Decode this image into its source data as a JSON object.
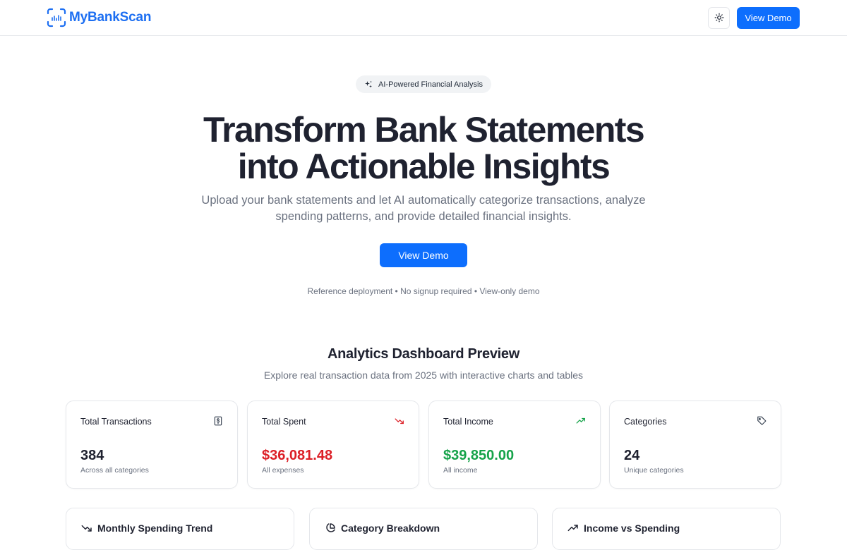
{
  "header": {
    "brand": "MyBankScan",
    "view_demo_label": "View Demo"
  },
  "hero": {
    "badge": "AI-Powered Financial Analysis",
    "title_line1": "Transform Bank Statements",
    "title_line2": "into Actionable Insights",
    "subtitle": "Upload your bank statements and let AI automatically categorize transactions, analyze spending patterns, and provide detailed financial insights.",
    "cta_label": "View Demo",
    "note": "Reference deployment • No signup required • View-only demo"
  },
  "preview": {
    "title": "Analytics Dashboard Preview",
    "subtitle": "Explore real transaction data from 2025 with interactive charts and tables",
    "stats": [
      {
        "label": "Total Transactions",
        "value": "384",
        "desc": "Across all categories",
        "icon": "receipt-icon",
        "color": "#1f2230"
      },
      {
        "label": "Total Spent",
        "value": "$36,081.48",
        "desc": "All expenses",
        "icon": "trending-down-icon",
        "color": "#dc1f26"
      },
      {
        "label": "Total Income",
        "value": "$39,850.00",
        "desc": "All income",
        "icon": "trending-up-icon",
        "color": "#16a34a"
      },
      {
        "label": "Categories",
        "value": "24",
        "desc": "Unique categories",
        "icon": "tag-icon",
        "color": "#1f2230"
      }
    ],
    "charts": [
      {
        "title": "Monthly Spending Trend",
        "icon": "trending-down-icon"
      },
      {
        "title": "Category Breakdown",
        "icon": "pie-chart-icon"
      },
      {
        "title": "Income vs Spending",
        "icon": "trending-up-icon"
      }
    ]
  },
  "colors": {
    "brand": "#1d6ff2",
    "primary": "#0d6efd",
    "spent": "#dc1f26",
    "income": "#16a34a"
  }
}
